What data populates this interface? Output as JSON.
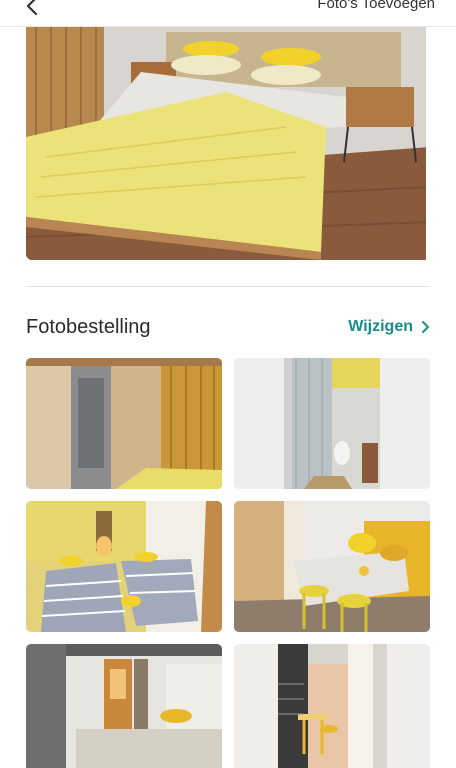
{
  "header": {
    "back_icon": "chevron-left-icon",
    "add_photos_label": "Foto's Toevoegen"
  },
  "section": {
    "title": "Fotobestelling",
    "edit_label": "Wijzigen",
    "edit_icon": "chevron-right-icon"
  },
  "colors": {
    "accent": "#1a8c8c"
  },
  "photos": [
    "hero-bedroom",
    "wardrobe-room",
    "bathroom-shower",
    "twin-beds-room",
    "dining-corner",
    "hallway-kitchen",
    "balcony-doorway"
  ]
}
